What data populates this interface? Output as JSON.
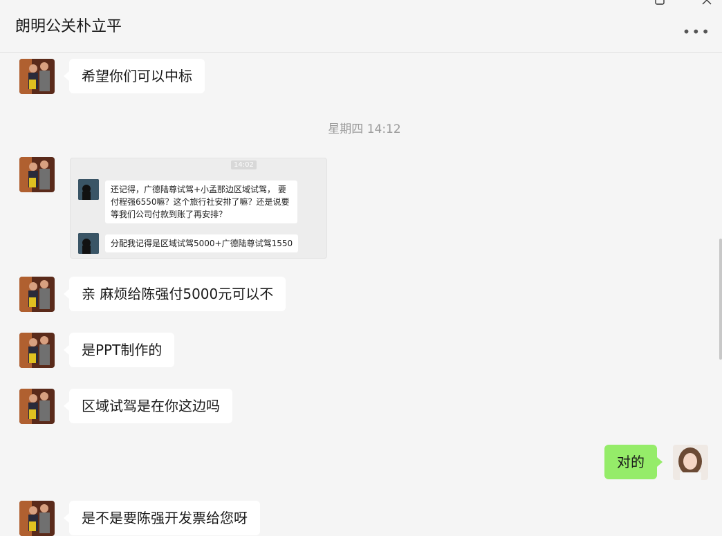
{
  "header": {
    "title": "朗明公关朴立平",
    "more_label": "•••"
  },
  "messages": {
    "m1": "希望你们可以中标",
    "timestamp": "星期四 14:12",
    "screenshot": {
      "time": "14:02",
      "line1": "还记得，广德陆尊试驾+小孟那边区域试驾， 要付程强6550嘛？这个旅行社安排了嘛？还是说要等我们公司付款到账了再安排？",
      "line2": "分配我记得是区域试驾5000+广德陆尊试驾1550"
    },
    "m2": "亲 麻烦给陈强付5000元可以不",
    "m3": "是PPT制作的",
    "m4": "区域试驾是在你这边吗",
    "m5": "对的",
    "m6": "是不是要陈强开发票给您呀"
  }
}
